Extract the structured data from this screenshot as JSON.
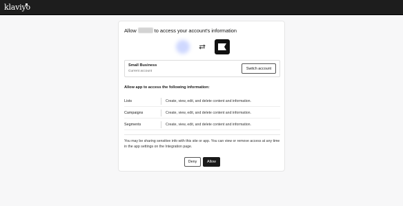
{
  "brand": {
    "name": "klaviyo"
  },
  "consent": {
    "title_prefix": "Allow",
    "title_suffix": "to access your account's information"
  },
  "account": {
    "name": "Small Business",
    "subtitle": "Current account",
    "switch_label": "Switch account"
  },
  "permissions": {
    "header": "Allow app to access the following information:",
    "items": [
      {
        "name": "Lists",
        "description": "Create, view, edit, and delete content and information."
      },
      {
        "name": "Campaigns",
        "description": "Create, view, edit, and delete content and information."
      },
      {
        "name": "Segments",
        "description": "Create, view, edit, and delete content and information."
      }
    ]
  },
  "disclaimer": "You may be sharing sensitive info with this site or app. You can view or remove access at any time in the app settings on the Integration page.",
  "actions": {
    "deny_label": "Deny",
    "allow_label": "Allow"
  },
  "icons": {
    "swap": "swap-arrows-icon",
    "brand": "klaviyo-flag-icon"
  },
  "colors": {
    "topbar": "#1d1d1d",
    "primary_button": "#1a1a1a"
  }
}
